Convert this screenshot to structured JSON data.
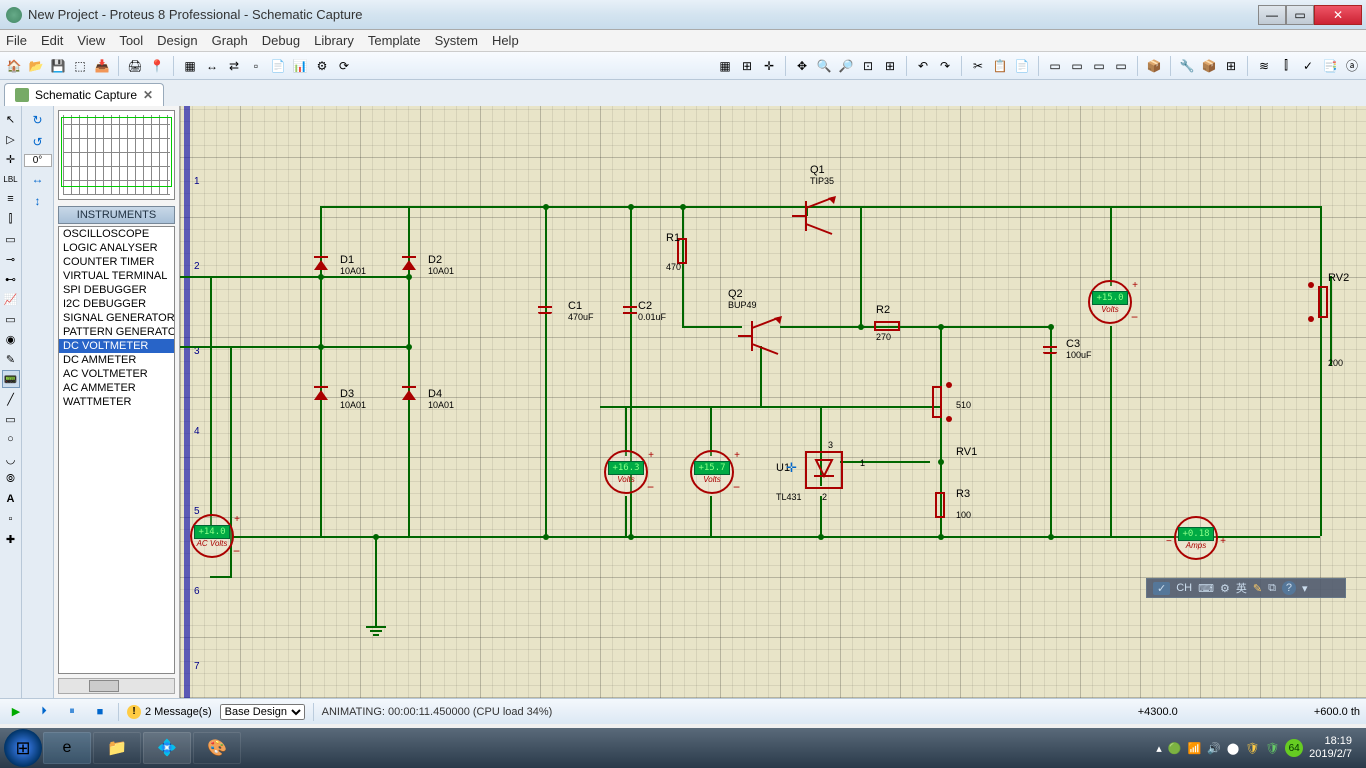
{
  "title": "New Project - Proteus 8 Professional - Schematic Capture",
  "menu": [
    "File",
    "Edit",
    "View",
    "Tool",
    "Design",
    "Graph",
    "Debug",
    "Library",
    "Template",
    "System",
    "Help"
  ],
  "tab": {
    "label": "Schematic Capture"
  },
  "rotate_deg": "0°",
  "panel_header": "INSTRUMENTS",
  "instruments": [
    "OSCILLOSCOPE",
    "LOGIC ANALYSER",
    "COUNTER TIMER",
    "VIRTUAL TERMINAL",
    "SPI DEBUGGER",
    "I2C DEBUGGER",
    "SIGNAL GENERATOR",
    "PATTERN GENERATO",
    "DC VOLTMETER",
    "DC AMMETER",
    "AC VOLTMETER",
    "AC AMMETER",
    "WATTMETER"
  ],
  "selected_instrument": "DC VOLTMETER",
  "ruler_ticks": [
    "1",
    "2",
    "3",
    "4",
    "5",
    "6",
    "7"
  ],
  "components": {
    "D1": {
      "ref": "D1",
      "val": "10A01"
    },
    "D2": {
      "ref": "D2",
      "val": "10A01"
    },
    "D3": {
      "ref": "D3",
      "val": "10A01"
    },
    "D4": {
      "ref": "D4",
      "val": "10A01"
    },
    "C1": {
      "ref": "C1",
      "val": "470uF"
    },
    "C2": {
      "ref": "C2",
      "val": "0.01uF"
    },
    "R1": {
      "ref": "R1",
      "val": "470"
    },
    "Q1": {
      "ref": "Q1",
      "val": "TIP35"
    },
    "Q2": {
      "ref": "Q2",
      "val": "BUP49"
    },
    "R2": {
      "ref": "R2",
      "val": "270"
    },
    "C3": {
      "ref": "C3",
      "val": "100uF"
    },
    "U1": {
      "ref": "U1",
      "val": "TL431"
    },
    "R3": {
      "ref": "R3",
      "val": "100"
    },
    "RV1": {
      "ref": "RV1",
      "val": "510"
    },
    "RV2": {
      "ref": "RV2",
      "val": "200"
    }
  },
  "meters": {
    "ac": {
      "value": "+14.0",
      "unit": "AC Volts"
    },
    "v1": {
      "value": "+16.3",
      "unit": "Volts"
    },
    "v2": {
      "value": "+15.7",
      "unit": "Volts"
    },
    "v3": {
      "value": "+15.0",
      "unit": "Volts"
    },
    "amp": {
      "value": "+0.18",
      "unit": "Amps"
    }
  },
  "pins": {
    "p3": "3",
    "p1": "1",
    "p2": "2"
  },
  "simbar": {
    "messages": "2 Message(s)",
    "design": "Base Design",
    "anim": "ANIMATING: 00:00:11.450000 (CPU load 34%)",
    "coordx": "+4300.0",
    "coordy": "+600.0  th"
  },
  "ime": {
    "ch": "CH",
    "btns": [
      "",
      "",
      "",
      "英",
      "",
      ""
    ]
  },
  "clock": {
    "time": "18:19",
    "date": "2019/2/7"
  },
  "tray_badge": "64"
}
